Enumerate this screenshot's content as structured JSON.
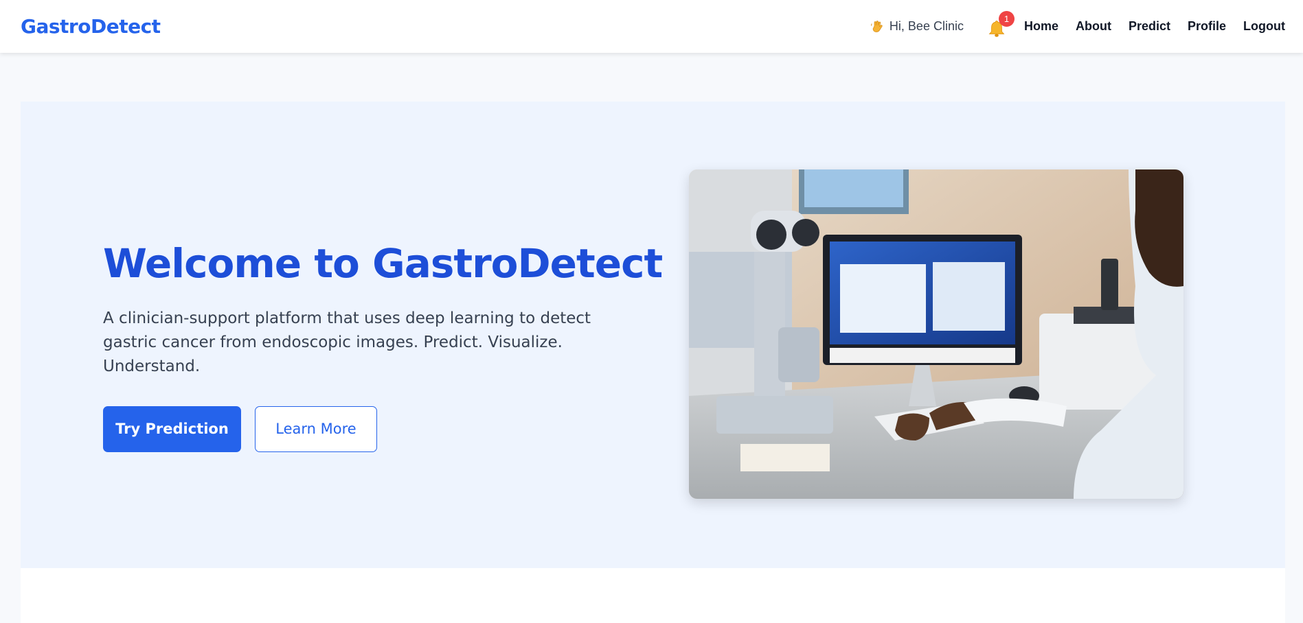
{
  "nav": {
    "brand": "GastroDetect",
    "greeting": "Hi, Bee Clinic",
    "notification_count": "1",
    "links": [
      "Home",
      "About",
      "Predict",
      "Profile",
      "Logout"
    ]
  },
  "hero": {
    "title": "Welcome to GastroDetect",
    "subtitle": "A clinician-support platform that uses deep learning to detect gastric cancer from endoscopic images. Predict. Visualize. Understand.",
    "primary_button": "Try Prediction",
    "secondary_button": "Learn More"
  },
  "icons": {
    "greeting": "waving-hand-icon",
    "notifications": "bell-icon"
  },
  "colors": {
    "brand": "#2563eb",
    "title": "#1d4ed8",
    "hero_bg": "#eef4fe",
    "badge": "#ef4444"
  }
}
